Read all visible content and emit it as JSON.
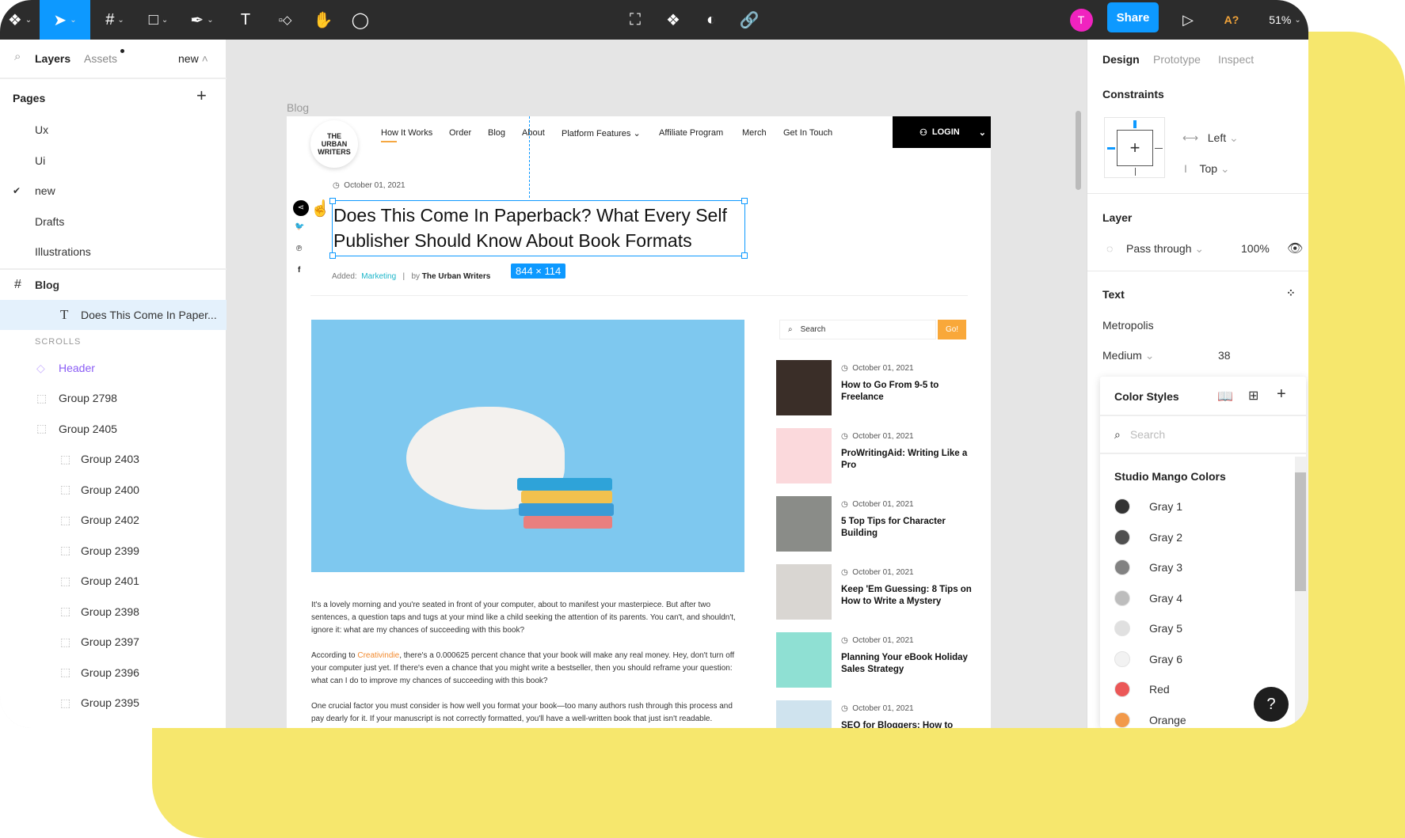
{
  "toolbar": {
    "share": "Share",
    "avatar_initial": "T",
    "zoom": "51%",
    "ai_label": "A?",
    "avatar_color": "#f023bf",
    "accent": "#0d99ff",
    "tools": [
      "figma-menu-icon",
      "move-tool-icon",
      "frame-tool-icon",
      "shape-tool-icon",
      "pen-tool-icon",
      "text-tool-icon",
      "components-icon",
      "hand-tool-icon",
      "comment-tool-icon"
    ],
    "center_tools": [
      "edit-object-icon",
      "component-icon",
      "mask-icon",
      "link-icon"
    ]
  },
  "left": {
    "tabs": {
      "layers": "Layers",
      "assets": "Assets",
      "page": "new"
    },
    "pages_title": "Pages",
    "pages": [
      "Ux",
      "Ui",
      "new",
      "Drafts",
      "Illustrations"
    ],
    "frame": "Blog",
    "selected_layer": "Does This Come In Paper...",
    "scrolls_label": "SCROLLS",
    "header_layer": "Header",
    "groups": [
      "Group 2798",
      "Group 2405"
    ],
    "subgroups": [
      "Group 2403",
      "Group 2400",
      "Group 2402",
      "Group 2399",
      "Group 2401",
      "Group 2398",
      "Group 2397",
      "Group 2396",
      "Group 2395"
    ]
  },
  "canvas": {
    "frame_label": "Blog",
    "size_badge": "844 × 114"
  },
  "site": {
    "logo": "THE URBAN WRITERS",
    "nav": [
      "How It Works",
      "Order",
      "Blog",
      "About",
      "Platform Features",
      "Affiliate Program",
      "Merch",
      "Get  In Touch"
    ],
    "login": "LOGIN",
    "date": "October 01, 2021",
    "title": "Does This Come In Paperback? What Every Self Publisher Should Know About Book Formats",
    "added_label": "Added:",
    "category": "Marketing",
    "by_label": "by",
    "author": "The Urban Writers",
    "p1": "It's a lovely morning and you're seated in front of your computer, about to manifest your  masterpiece. But after two sentences, a question taps and tugs at your mind like a child seeking the attention of its parents. You can't, and shouldn't, ignore it: what are my chances of succeeding with this book?",
    "p2_pre": "According to ",
    "p2_link": "Creativindie",
    "p2_post": ", there's a 0.000625 percent chance that your book will make any real money. Hey, don't turn off your computer just yet. If there's even a chance that you might write a bestseller, then you should reframe your question: what can I do to improve my chances of succeeding with this book?",
    "p3": "One crucial factor you must consider is how well you format your book—too many authors rush through this process and pay dearly for it. If your manuscript is not correctly formatted, you'll have a well-written book that just isn't readable.",
    "search_placeholder": "Search",
    "go": "Go!",
    "posts": [
      {
        "date": "October 01, 2021",
        "title": "How to Go From 9-5 to Freelance",
        "color": "#3a2e28"
      },
      {
        "date": "October 01, 2021",
        "title": "ProWritingAid: Writing Like a Pro",
        "color": "#fbd9dc"
      },
      {
        "date": "October 01, 2021",
        "title": "5 Top Tips for Character Building",
        "color": "#8a8c88"
      },
      {
        "date": "October 01, 2021",
        "title": "Keep 'Em Guessing: 8 Tips on How to Write a Mystery",
        "color": "#d9d6d2"
      },
      {
        "date": "October 01, 2021",
        "title": "Planning Your eBook Holiday Sales Strategy",
        "color": "#8fe0d3"
      },
      {
        "date": "October 01, 2021",
        "title": "SEO for Bloggers: How to",
        "color": "#cfe3ee"
      }
    ]
  },
  "right": {
    "tabs": [
      "Design",
      "Prototype",
      "Inspect"
    ],
    "constraints": "Constraints",
    "h_constraint": "Left",
    "v_constraint": "Top",
    "layer": "Layer",
    "blend": "Pass through",
    "opacity": "100%",
    "text": "Text",
    "font": "Metropolis",
    "weight": "Medium",
    "size": "38",
    "color_styles": {
      "title": "Color Styles",
      "search_placeholder": "Search",
      "group": "Studio Mango Colors",
      "items": [
        {
          "name": "Gray 1",
          "color": "#333333"
        },
        {
          "name": "Gray 2",
          "color": "#4f4f4f"
        },
        {
          "name": "Gray 3",
          "color": "#828282"
        },
        {
          "name": "Gray 4",
          "color": "#bdbdbd"
        },
        {
          "name": "Gray 5",
          "color": "#e0e0e0"
        },
        {
          "name": "Gray 6",
          "color": "#f2f2f2"
        },
        {
          "name": "Red",
          "color": "#eb5757"
        },
        {
          "name": "Orange",
          "color": "#f2994a"
        }
      ]
    },
    "help": "?"
  }
}
